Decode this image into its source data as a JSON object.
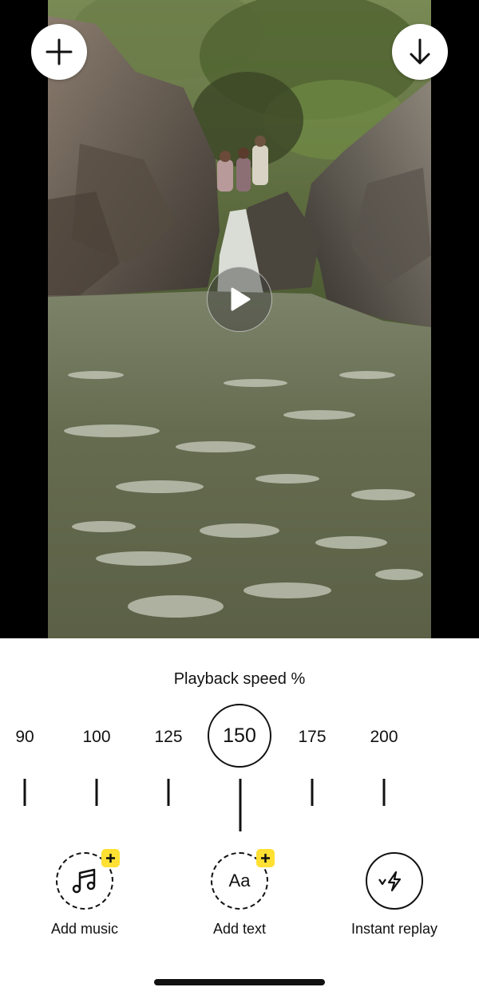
{
  "video": {
    "add_icon": "plus-icon",
    "download_icon": "arrow-down-icon",
    "play_icon": "play-icon"
  },
  "speed": {
    "title": "Playback speed %",
    "options": [
      "90",
      "100",
      "125",
      "150",
      "175",
      "200"
    ],
    "selected": "150"
  },
  "tools": [
    {
      "label": "Add music",
      "icon": "music-note-icon",
      "badge": "plus-icon"
    },
    {
      "label": "Add text",
      "icon": "text-aa-icon",
      "icon_text": "Aa",
      "badge": "plus-icon"
    },
    {
      "label": "Instant replay",
      "icon": "replay-bolt-icon"
    }
  ],
  "colors": {
    "badge": "#ffe033",
    "background": "#ffffff",
    "letterbox": "#000000"
  }
}
